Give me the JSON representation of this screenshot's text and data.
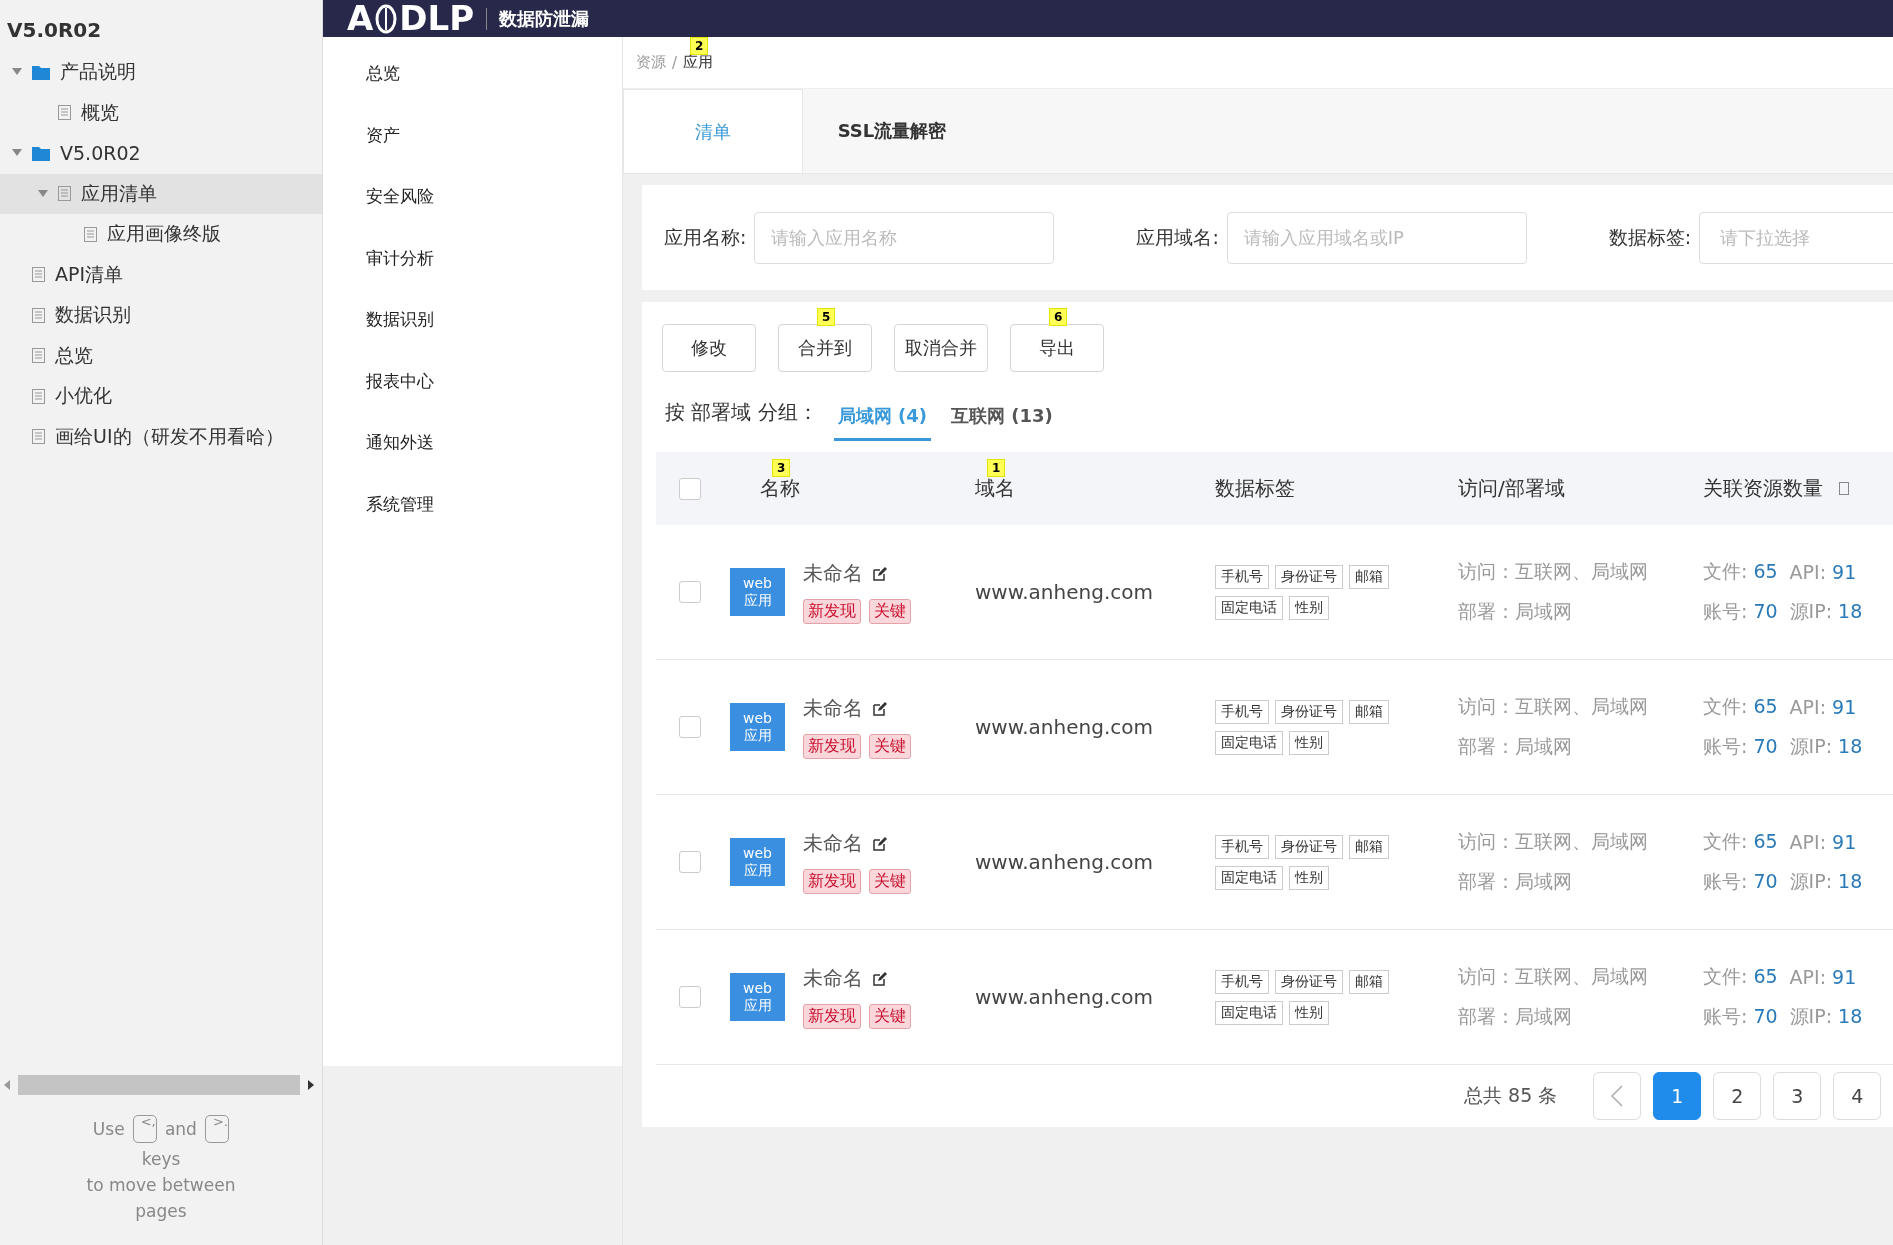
{
  "sidebar": {
    "title": "V5.0R02",
    "tree": [
      {
        "label": "产品说明",
        "kind": "folder",
        "expanded": true,
        "selected": false,
        "children": [
          {
            "label": "概览",
            "kind": "page",
            "selected": false
          }
        ]
      },
      {
        "label": "V5.0R02",
        "kind": "folder",
        "expanded": true,
        "selected": false,
        "children": [
          {
            "label": "应用清单",
            "kind": "page",
            "expanded": true,
            "selected": true,
            "children": [
              {
                "label": "应用画像终版",
                "kind": "page",
                "selected": false
              }
            ]
          }
        ]
      },
      {
        "label": "API清单",
        "kind": "page",
        "selected": false
      },
      {
        "label": "数据识别",
        "kind": "page",
        "selected": false
      },
      {
        "label": "总览",
        "kind": "page",
        "selected": false
      },
      {
        "label": "小优化",
        "kind": "page",
        "selected": false
      },
      {
        "label": "画给UI的（研发不用看哈）",
        "kind": "page",
        "selected": false
      }
    ],
    "help": {
      "before": "Use",
      "key_prev": "<,",
      "middle": "and",
      "key_next": ">.",
      "lines": [
        "keys",
        "to move between",
        "pages"
      ]
    }
  },
  "header": {
    "logo_left": "A",
    "logo_right": "DLP",
    "product": "数据防泄漏"
  },
  "nav": [
    {
      "label": "总览",
      "selected": false
    },
    {
      "label": "资产",
      "selected": false
    },
    {
      "label": "安全风险",
      "selected": false
    },
    {
      "label": "审计分析",
      "selected": false
    },
    {
      "label": "数据识别",
      "selected": false
    },
    {
      "label": "报表中心",
      "selected": false
    },
    {
      "label": "通知外送",
      "selected": false
    },
    {
      "label": "系统管理",
      "selected": false
    }
  ],
  "breadcrumb": {
    "separator": "/",
    "items": [
      {
        "label": "资源"
      },
      {
        "label": "应用",
        "note": "2"
      }
    ]
  },
  "tabs": [
    {
      "label": "清单",
      "selected": true
    },
    {
      "label": "SSL流量解密",
      "selected": false
    }
  ],
  "filters": [
    {
      "label": "应用名称:",
      "kind": "input",
      "placeholder": "请输入应用名称"
    },
    {
      "label": "应用域名:",
      "kind": "input",
      "placeholder": "请输入应用域名或IP"
    },
    {
      "label": "数据标签:",
      "kind": "select",
      "placeholder": "请下拉选择"
    }
  ],
  "actions": [
    {
      "label": "修改"
    },
    {
      "label": "合并到",
      "note": "5"
    },
    {
      "label": "取消合并"
    },
    {
      "label": "导出",
      "note": "6"
    }
  ],
  "grouping": {
    "label": "按 部署域 分组：",
    "options": [
      {
        "label": "局域网",
        "count": "(4)",
        "selected": true
      },
      {
        "label": "互联网",
        "count": "(13)",
        "selected": false
      }
    ]
  },
  "table": {
    "select_all_checked": false,
    "columns": [
      {
        "label": "名称",
        "note": "3"
      },
      {
        "label": "域名",
        "note": "1"
      },
      {
        "label": "数据标签"
      },
      {
        "label": "访问/部署域"
      },
      {
        "label": "关联资源数量",
        "has_icon": true
      }
    ],
    "rows": [
      {
        "checked": false,
        "badge": [
          "web",
          "应用"
        ],
        "name": "未命名",
        "flags": [
          "新发现",
          "关键"
        ],
        "domain": "www.anheng.com",
        "data_tags": [
          "手机号",
          "身份证号",
          "邮箱",
          "固定电话",
          "性别"
        ],
        "access": "访问：互联网、局域网",
        "deploy": "部署：局域网",
        "counts": [
          {
            "label": "文件:",
            "value": "65"
          },
          {
            "label": "API:",
            "value": "91"
          },
          {
            "label": "账号:",
            "value": "70"
          },
          {
            "label": "源IP:",
            "value": "18"
          }
        ]
      },
      {
        "checked": false,
        "badge": [
          "web",
          "应用"
        ],
        "name": "未命名",
        "flags": [
          "新发现",
          "关键"
        ],
        "domain": "www.anheng.com",
        "data_tags": [
          "手机号",
          "身份证号",
          "邮箱",
          "固定电话",
          "性别"
        ],
        "access": "访问：互联网、局域网",
        "deploy": "部署：局域网",
        "counts": [
          {
            "label": "文件:",
            "value": "65"
          },
          {
            "label": "API:",
            "value": "91"
          },
          {
            "label": "账号:",
            "value": "70"
          },
          {
            "label": "源IP:",
            "value": "18"
          }
        ]
      },
      {
        "checked": false,
        "badge": [
          "web",
          "应用"
        ],
        "name": "未命名",
        "flags": [
          "新发现",
          "关键"
        ],
        "domain": "www.anheng.com",
        "data_tags": [
          "手机号",
          "身份证号",
          "邮箱",
          "固定电话",
          "性别"
        ],
        "access": "访问：互联网、局域网",
        "deploy": "部署：局域网",
        "counts": [
          {
            "label": "文件:",
            "value": "65"
          },
          {
            "label": "API:",
            "value": "91"
          },
          {
            "label": "账号:",
            "value": "70"
          },
          {
            "label": "源IP:",
            "value": "18"
          }
        ]
      },
      {
        "checked": false,
        "badge": [
          "web",
          "应用"
        ],
        "name": "未命名",
        "flags": [
          "新发现",
          "关键"
        ],
        "domain": "www.anheng.com",
        "data_tags": [
          "手机号",
          "身份证号",
          "邮箱",
          "固定电话",
          "性别"
        ],
        "access": "访问：互联网、局域网",
        "deploy": "部署：局域网",
        "counts": [
          {
            "label": "文件:",
            "value": "65"
          },
          {
            "label": "API:",
            "value": "91"
          },
          {
            "label": "账号:",
            "value": "70"
          },
          {
            "label": "源IP:",
            "value": "18"
          }
        ]
      }
    ]
  },
  "pagination": {
    "total": "总共 85 条",
    "pages": [
      {
        "label": "1",
        "selected": true
      },
      {
        "label": "2",
        "selected": false
      },
      {
        "label": "3",
        "selected": false
      },
      {
        "label": "4",
        "selected": false
      }
    ]
  }
}
